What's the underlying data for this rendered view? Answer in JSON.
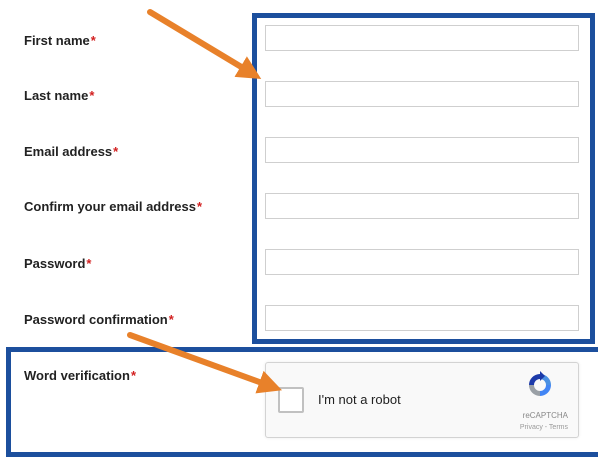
{
  "form": {
    "required_marker": "*",
    "fields": [
      {
        "label": "First name",
        "value": ""
      },
      {
        "label": "Last name",
        "value": ""
      },
      {
        "label": "Email address",
        "value": ""
      },
      {
        "label": "Confirm your email address",
        "value": ""
      },
      {
        "label": "Password",
        "value": ""
      },
      {
        "label": "Password confirmation",
        "value": ""
      }
    ],
    "verification": {
      "label": "Word verification"
    }
  },
  "recaptcha": {
    "checkbox_label": "I'm not a robot",
    "brand": "reCAPTCHA",
    "links": "Privacy - Terms",
    "checked": false,
    "icon": "recaptcha-logo-icon"
  },
  "annotations": {
    "highlight_color": "#1c4f9d",
    "arrow_color": "#e8812a",
    "required_color": "#d21f1f"
  }
}
